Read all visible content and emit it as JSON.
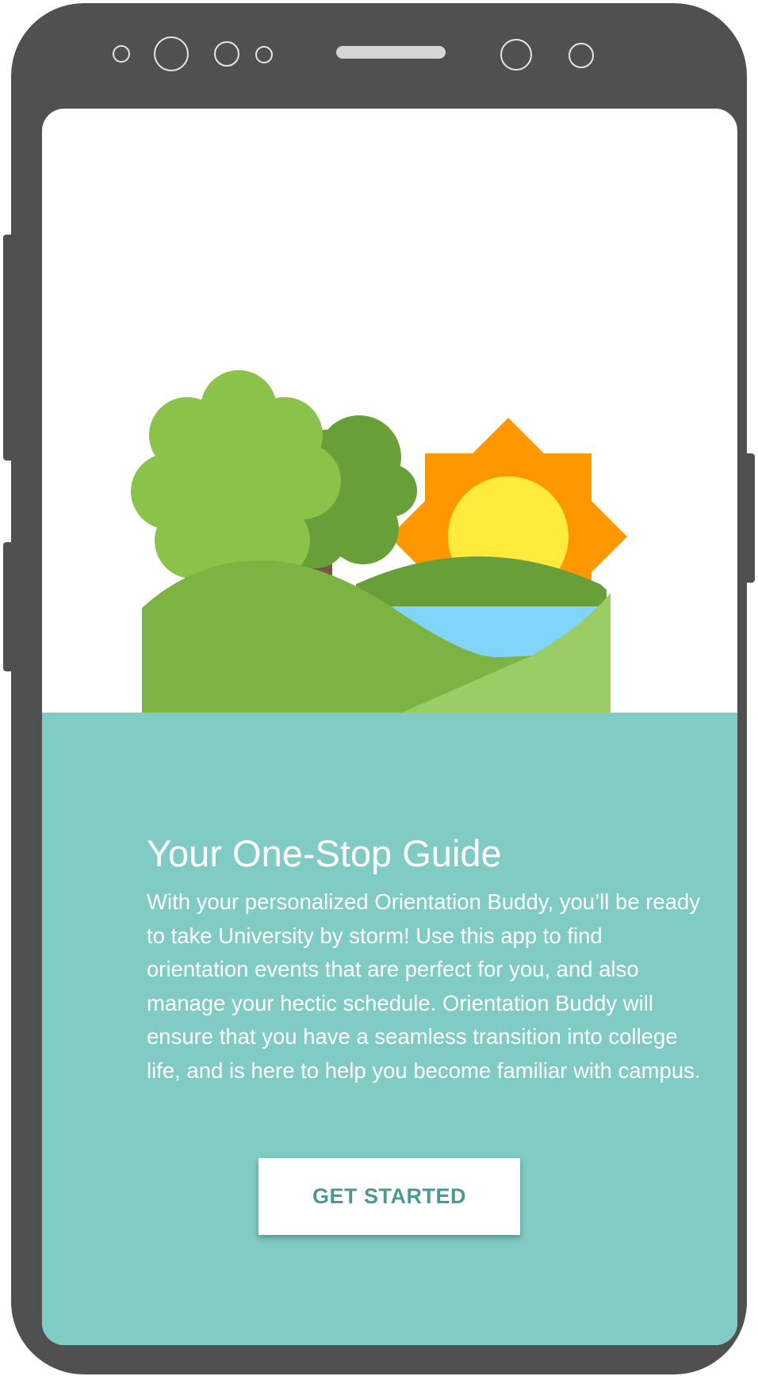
{
  "onboarding": {
    "title": "Your One-Stop Guide",
    "description": "With your personalized Orientation Buddy, you’ll be ready to take University by storm! Use this app to find orientation events that are perfect for you, and also manage your hectic schedule. Orientation Buddy will ensure that you have a seamless transition into college life, and is here to help you become familiar with campus.",
    "cta_label": "GET STARTED"
  },
  "colors": {
    "device_frame": "#505050",
    "content_background": "#80cbc4",
    "button_text": "#4a9a91",
    "tree_light": "#8bc34a",
    "tree_dark": "#689f38",
    "trunk": "#795548",
    "sun_rays": "#ff9800",
    "sun": "#ffeb3b",
    "water": "#81d4fa",
    "hill_front": "#7cb342",
    "hill_right": "#9ccc65"
  }
}
